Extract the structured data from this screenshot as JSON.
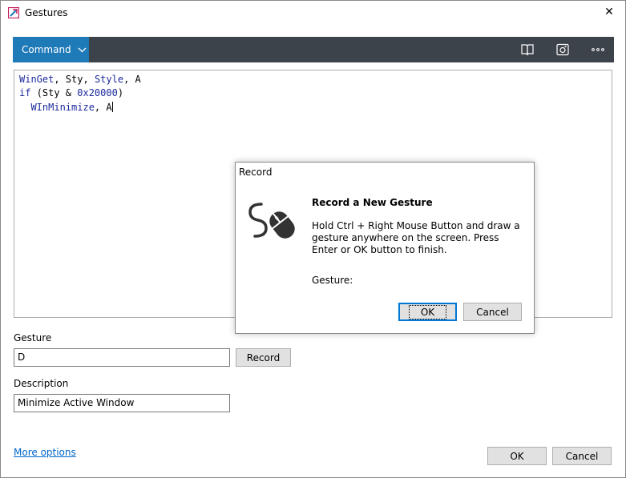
{
  "window": {
    "title": "Gestures",
    "close_glyph": "✕"
  },
  "toolbar": {
    "command_label": "Command",
    "icons": [
      "book-icon",
      "screenshot-icon",
      "more-icon"
    ],
    "colors": {
      "toolbar_bg": "#3d434a",
      "command_bg": "#1f7ab8"
    }
  },
  "editor": {
    "lines": [
      {
        "parts": [
          [
            "WinGet",
            "kw"
          ],
          [
            ", Sty, ",
            ""
          ],
          [
            "Style",
            "kw"
          ],
          [
            ", A",
            ""
          ]
        ]
      },
      {
        "parts": [
          [
            "if",
            "kw"
          ],
          [
            " (Sty & ",
            ""
          ],
          [
            "0x20000",
            "kw"
          ],
          [
            ")",
            ""
          ]
        ]
      },
      {
        "parts": [
          [
            "  WInMinimize",
            "kw"
          ],
          [
            ", A",
            ""
          ]
        ]
      }
    ]
  },
  "form": {
    "gesture_label": "Gesture",
    "gesture_value": "D",
    "record_button": "Record",
    "description_label": "Description",
    "description_value": "Minimize Active Window",
    "more_options": "More options",
    "ok_button": "OK",
    "cancel_button": "Cancel"
  },
  "record_dialog": {
    "title": "Record",
    "heading": "Record a New Gesture",
    "message": "Hold Ctrl + Right Mouse Button and draw a gesture anywhere on the screen. Press Enter or OK button to finish.",
    "gesture_label": "Gesture:",
    "ok_button": "OK",
    "cancel_button": "Cancel",
    "icon": "mouse-gesture-icon"
  }
}
